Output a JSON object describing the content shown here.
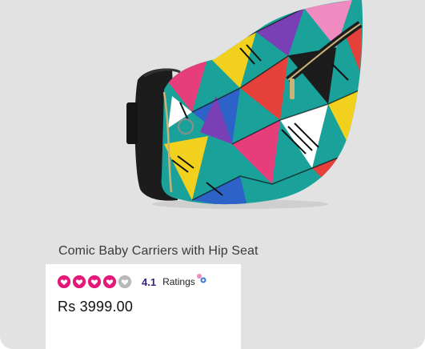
{
  "product": {
    "title": "Comic Baby Carriers with Hip Seat",
    "image_icon": "baby-carrier-product-photo",
    "rating": {
      "value": "4.1",
      "label": "Ratings",
      "stars_total": 5,
      "stars_filled": 4,
      "filled_color": "#e5197a",
      "empty_color": "#b9b9b9"
    },
    "price": "Rs 3999.00"
  },
  "colors": {
    "card_background": "#e3e2e3",
    "panel_background": "#ffffff",
    "rating_value": "#3b1f7a"
  }
}
